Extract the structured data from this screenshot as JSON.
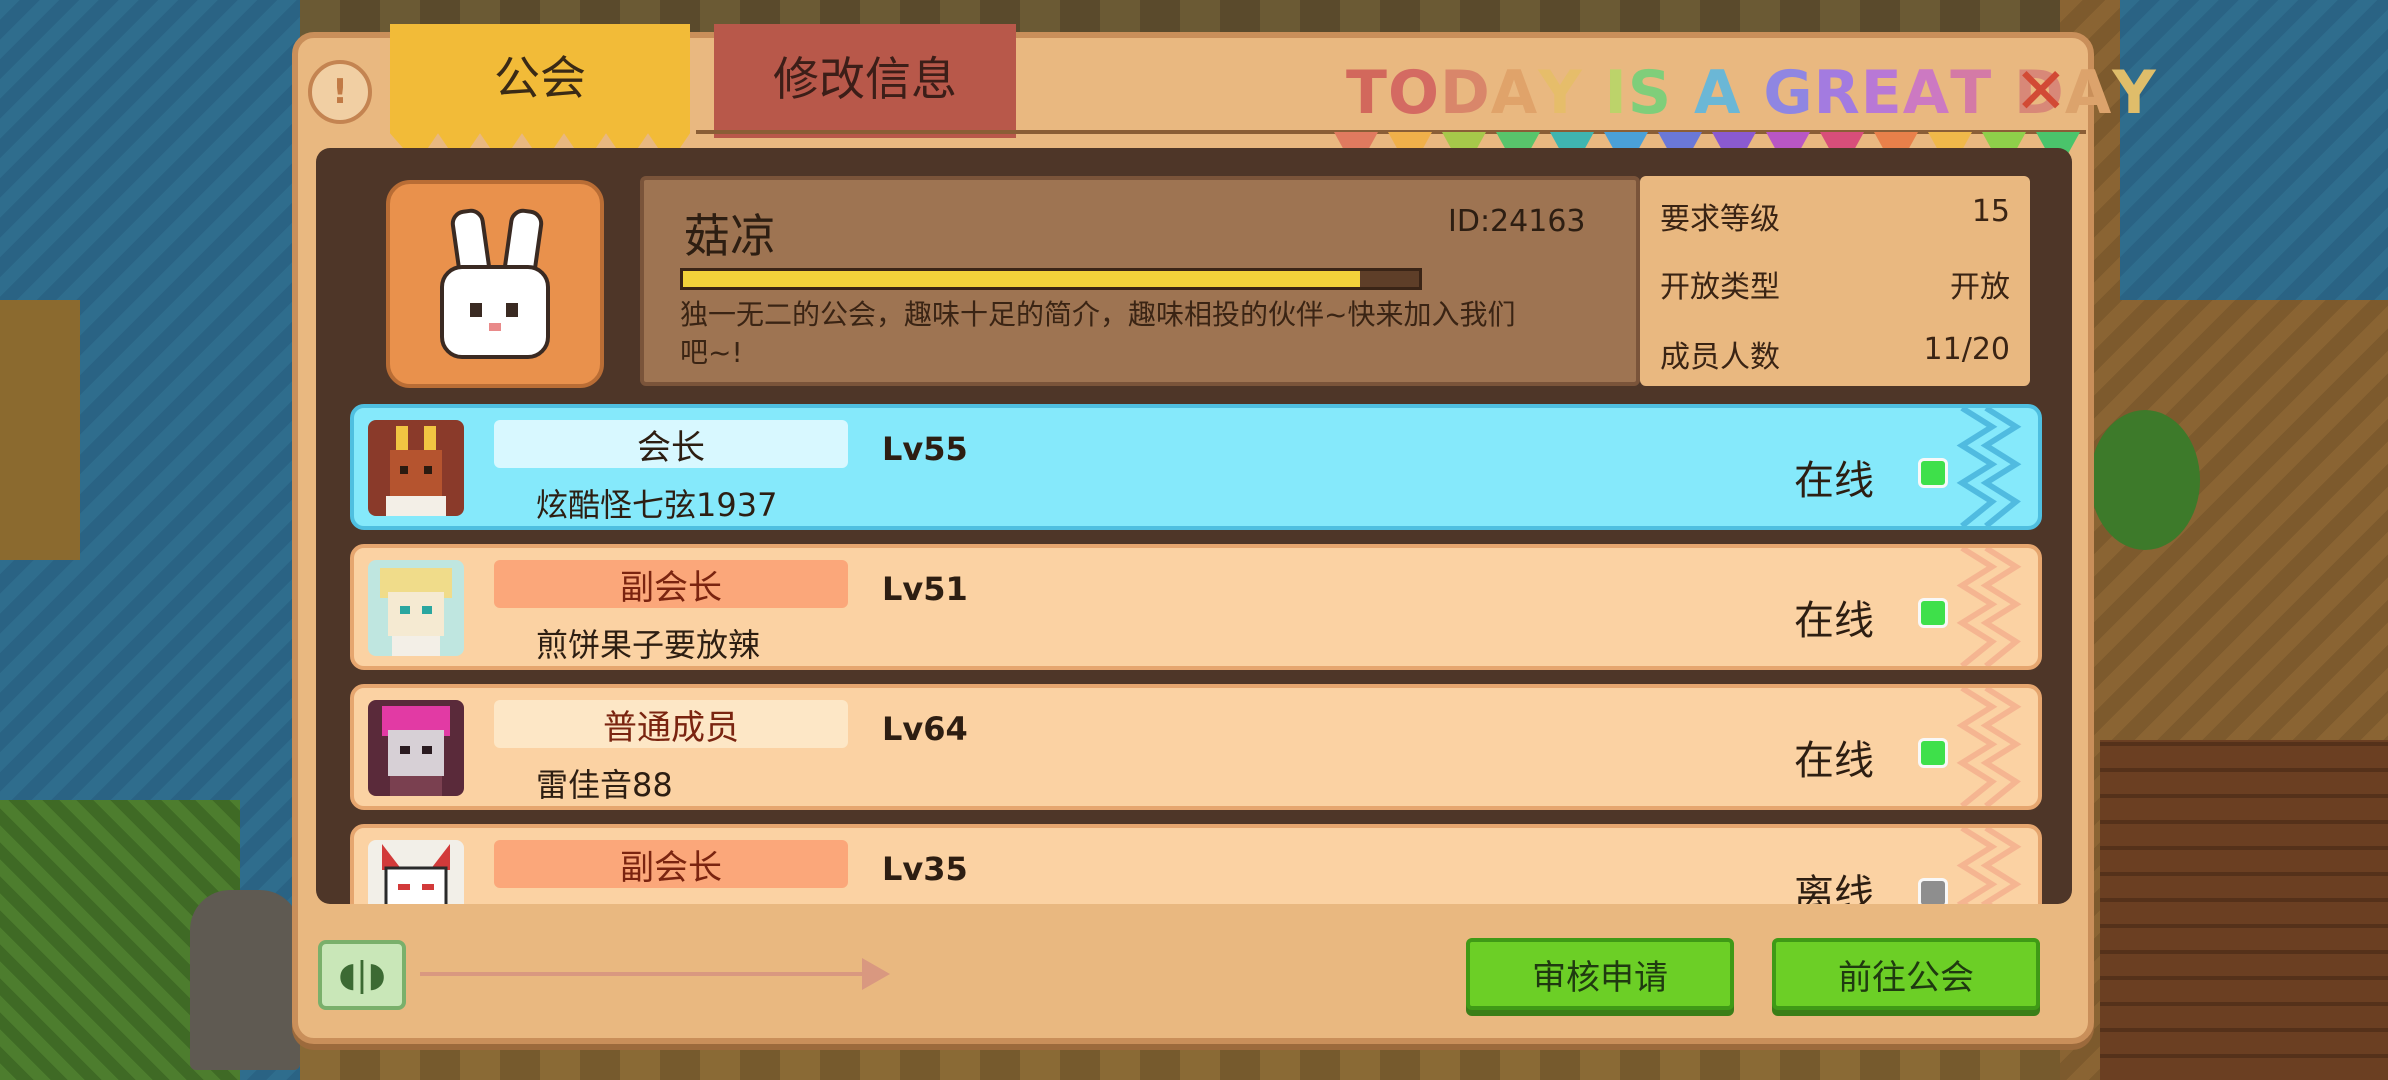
{
  "tabs": [
    {
      "label": "公会",
      "active": true
    },
    {
      "label": "修改信息",
      "active": false
    }
  ],
  "banner": {
    "text": "TODAY IS A GREAT DAY"
  },
  "guild": {
    "name": "菇凉",
    "id": "ID:24163",
    "description": "独一无二的公会，趣味十足的简介，趣味相投的伙伴~快来加入我们吧~!",
    "progress": 0.92
  },
  "stats": [
    {
      "label": "要求等级",
      "value": "15"
    },
    {
      "label": "开放类型",
      "value": "开放"
    },
    {
      "label": "成员人数",
      "value": "11/20"
    }
  ],
  "members": [
    {
      "role": "会长",
      "name": "炫酷怪七弦1937",
      "level": "Lv55",
      "status": "在线",
      "online": true,
      "highlight": true
    },
    {
      "role": "副会长",
      "name": "煎饼果子要放辣",
      "level": "Lv51",
      "status": "在线",
      "online": true,
      "highlight": false
    },
    {
      "role": "普通成员",
      "name": "雷佳音88",
      "level": "Lv64",
      "status": "在线",
      "online": true,
      "highlight": false
    },
    {
      "role": "副会长",
      "name": "",
      "level": "Lv35",
      "status": "离线",
      "online": false,
      "highlight": false
    }
  ],
  "buttons": {
    "review": "审核申请",
    "go_guild": "前往公会"
  },
  "colors": {
    "online": "#3ee04a",
    "offline": "#8e8e8e",
    "role_leader_bg": "#d8f8ff",
    "role_vice_bg": "#fba77a",
    "role_normal_bg": "#fde7c6",
    "button_green": "#6ccf26"
  },
  "icons": {
    "info": "info-icon",
    "close": "close-x-icon",
    "chat": "chat-voice-icon"
  }
}
